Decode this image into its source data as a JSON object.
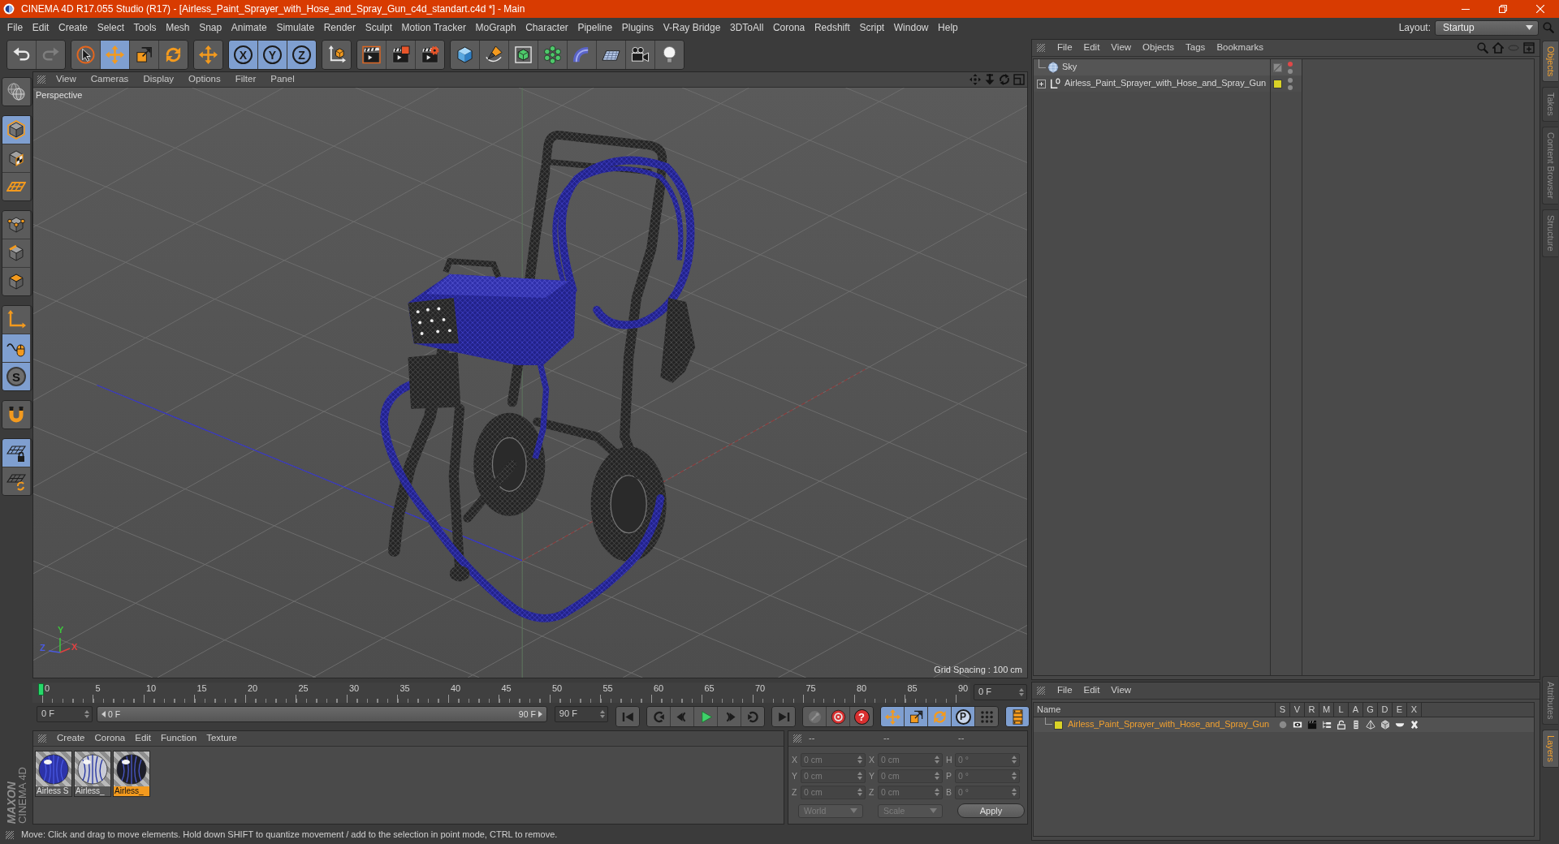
{
  "window": {
    "title": "CINEMA 4D R17.055 Studio (R17) - [Airless_Paint_Sprayer_with_Hose_and_Spray_Gun_c4d_standart.c4d *] - Main"
  },
  "menu": [
    "File",
    "Edit",
    "Create",
    "Select",
    "Tools",
    "Mesh",
    "Snap",
    "Animate",
    "Simulate",
    "Render",
    "Sculpt",
    "Motion Tracker",
    "MoGraph",
    "Character",
    "Pipeline",
    "Plugins",
    "V-Ray Bridge",
    "3DToAll",
    "Corona",
    "Redshift",
    "Script",
    "Window",
    "Help"
  ],
  "layout": {
    "label": "Layout:",
    "value": "Startup"
  },
  "toolbar": [
    [
      {
        "kind": "undo",
        "selected": false,
        "disabled": false
      },
      {
        "kind": "redo",
        "selected": false,
        "disabled": true
      }
    ],
    [
      {
        "kind": "select",
        "selected": false,
        "disabled": false
      },
      {
        "kind": "move",
        "selected": true,
        "disabled": false
      },
      {
        "kind": "scale",
        "selected": false,
        "disabled": false
      },
      {
        "kind": "rotate",
        "selected": false,
        "disabled": false
      }
    ],
    [
      {
        "kind": "move",
        "selected": false,
        "disabled": false
      }
    ],
    [
      {
        "kind": "axis-lock",
        "label": "X",
        "selected": true,
        "disabled": false
      },
      {
        "kind": "axis-lock",
        "label": "Y",
        "selected": true,
        "disabled": false
      },
      {
        "kind": "axis-lock",
        "label": "Z",
        "selected": true,
        "disabled": false
      }
    ],
    [
      {
        "kind": "coords",
        "selected": false,
        "disabled": false
      }
    ],
    [
      {
        "kind": "render-view",
        "selected": false,
        "disabled": false
      },
      {
        "kind": "render",
        "selected": false,
        "disabled": false
      },
      {
        "kind": "render-settings",
        "selected": false,
        "disabled": false
      }
    ],
    [
      {
        "kind": "cube",
        "selected": false,
        "disabled": false
      },
      {
        "kind": "pen",
        "selected": false,
        "disabled": false
      },
      {
        "kind": "subdiv",
        "selected": false,
        "disabled": false
      },
      {
        "kind": "array",
        "selected": false,
        "disabled": false
      },
      {
        "kind": "deformer",
        "selected": false,
        "disabled": false
      },
      {
        "kind": "floor",
        "selected": false,
        "disabled": false
      },
      {
        "kind": "camera",
        "selected": false,
        "disabled": false
      },
      {
        "kind": "light",
        "selected": false,
        "disabled": false
      }
    ]
  ],
  "left_toolbar": [
    [
      {
        "kind": "viewport-solo",
        "selected": false
      }
    ],
    [
      {
        "kind": "model",
        "selected": true
      },
      {
        "kind": "texture",
        "selected": false
      },
      {
        "kind": "workplane",
        "selected": false
      }
    ],
    [
      {
        "kind": "points",
        "selected": false
      },
      {
        "kind": "edges",
        "selected": false
      },
      {
        "kind": "polygons",
        "selected": false
      }
    ],
    [
      {
        "kind": "axis",
        "selected": false
      },
      {
        "kind": "tweak",
        "selected": true
      },
      {
        "kind": "soft-select",
        "label": "S",
        "selected": true
      }
    ],
    [
      {
        "kind": "snap",
        "selected": false
      }
    ],
    [
      {
        "kind": "lock-workplane",
        "selected": true
      },
      {
        "kind": "planar-workplane",
        "selected": false
      }
    ]
  ],
  "viewport": {
    "menu": [
      "View",
      "Cameras",
      "Display",
      "Options",
      "Filter",
      "Panel"
    ],
    "camera": "Perspective",
    "gizmo_labels": [
      {
        "label": "Y",
        "color": "#3cc83c"
      },
      {
        "label": "Z",
        "color": "#4a5ae0"
      },
      {
        "label": "X",
        "color": "#e04040"
      }
    ],
    "grid_spacing": "Grid Spacing : 100 cm"
  },
  "timeline": {
    "frames": [
      "0",
      "5",
      "10",
      "15",
      "20",
      "25",
      "30",
      "35",
      "40",
      "45",
      "50",
      "55",
      "60",
      "65",
      "70",
      "75",
      "80",
      "85",
      "90"
    ],
    "level": 0,
    "current": "0 F",
    "start": "0 F",
    "range": {
      "start": "0 F",
      "end": "90 F"
    },
    "end": "90 F"
  },
  "transport": [
    [
      {
        "kind": "start",
        "selected": false,
        "disabled": false
      }
    ],
    [
      {
        "kind": "prev-key",
        "selected": false,
        "disabled": false
      },
      {
        "kind": "prev-frame",
        "selected": false,
        "disabled": false
      },
      {
        "kind": "play",
        "selected": false,
        "disabled": false
      },
      {
        "kind": "next-frame",
        "selected": false,
        "disabled": false
      },
      {
        "kind": "next-key",
        "selected": false,
        "disabled": false
      }
    ],
    [
      {
        "kind": "end",
        "selected": false,
        "disabled": false
      }
    ],
    [
      {
        "kind": "keyframe",
        "selected": false,
        "disabled": true
      },
      {
        "kind": "record",
        "selected": false,
        "disabled": false
      },
      {
        "kind": "autokey",
        "label": "?",
        "selected": false,
        "disabled": false
      }
    ],
    [
      {
        "kind": "key-move",
        "selected": true,
        "disabled": false
      },
      {
        "kind": "key-scale",
        "selected": true,
        "disabled": false
      },
      {
        "kind": "key-rotate",
        "selected": true,
        "disabled": false
      },
      {
        "kind": "key-param",
        "label": "P",
        "selected": true,
        "disabled": false
      },
      {
        "kind": "key-points",
        "selected": false,
        "disabled": false
      }
    ],
    [
      {
        "kind": "timeline",
        "selected": true,
        "disabled": false
      }
    ]
  ],
  "materials": {
    "menu": [
      "Create",
      "Corona",
      "Edit",
      "Function",
      "Texture"
    ],
    "items": [
      {
        "name": "Airless S",
        "color": "#2c33a8",
        "selected": false
      },
      {
        "name": "Airless_",
        "color": "#c9cbd6",
        "selected": false
      },
      {
        "name": "Airless_",
        "color": "#1d1e2a",
        "selected": true
      }
    ]
  },
  "coordinates": {
    "headers": [
      "--",
      "--",
      "--"
    ],
    "disabled": true,
    "columns": [
      [
        {
          "axis": "X",
          "value": "0 cm"
        },
        {
          "axis": "Y",
          "value": "0 cm"
        },
        {
          "axis": "Z",
          "value": "0 cm"
        }
      ],
      [
        {
          "axis": "X",
          "value": "0 cm"
        },
        {
          "axis": "Y",
          "value": "0 cm"
        },
        {
          "axis": "Z",
          "value": "0 cm"
        }
      ],
      [
        {
          "axis": "H",
          "value": "0 °"
        },
        {
          "axis": "P",
          "value": "0 °"
        },
        {
          "axis": "B",
          "value": "0 °"
        }
      ]
    ],
    "dropdowns": [
      "World",
      "Scale"
    ],
    "apply": "Apply"
  },
  "logo": [
    "MAXON",
    "CINEMA 4D"
  ],
  "status_bar": "Move: Click and drag to move elements. Hold down SHIFT to quantize movement / add to the selection in point mode, CTRL to remove.",
  "objects": {
    "menu": [
      "File",
      "Edit",
      "View",
      "Objects",
      "Tags",
      "Bookmarks"
    ],
    "rows": [
      {
        "name": "Sky",
        "kind": "sky",
        "dots": [
          {
            "color": "#e04848"
          },
          {
            "color": "#8c8c8c"
          }
        ]
      },
      {
        "name": "Airless_Paint_Sprayer_with_Hose_and_Spray_Gun",
        "kind": "null",
        "expanded": false,
        "color": "#d9d227",
        "dots": [
          {
            "color": "#8c8c8c"
          },
          {
            "color": "#8c8c8c"
          }
        ]
      }
    ]
  },
  "layers": {
    "menu": [
      "File",
      "Edit",
      "View"
    ],
    "columns": [
      "Name",
      "S",
      "V",
      "R",
      "M",
      "L",
      "A",
      "G",
      "D",
      "E",
      "X"
    ],
    "rows": [
      {
        "name": "Airless_Paint_Sprayer_with_Hose_and_Spray_Gun",
        "color": "#d9d227",
        "selected": true,
        "flags": [
          false,
          true,
          true,
          true,
          false,
          true,
          true,
          true,
          true,
          true
        ]
      }
    ]
  },
  "side_tabs": {
    "top": [
      {
        "label": "Objects",
        "selected": true
      },
      {
        "label": "Takes",
        "selected": false
      },
      {
        "label": "Content Browser",
        "selected": false
      },
      {
        "label": "Structure",
        "selected": false
      }
    ],
    "bottom": [
      {
        "label": "Attributes",
        "selected": false
      },
      {
        "label": "Layers",
        "selected": true
      }
    ]
  }
}
